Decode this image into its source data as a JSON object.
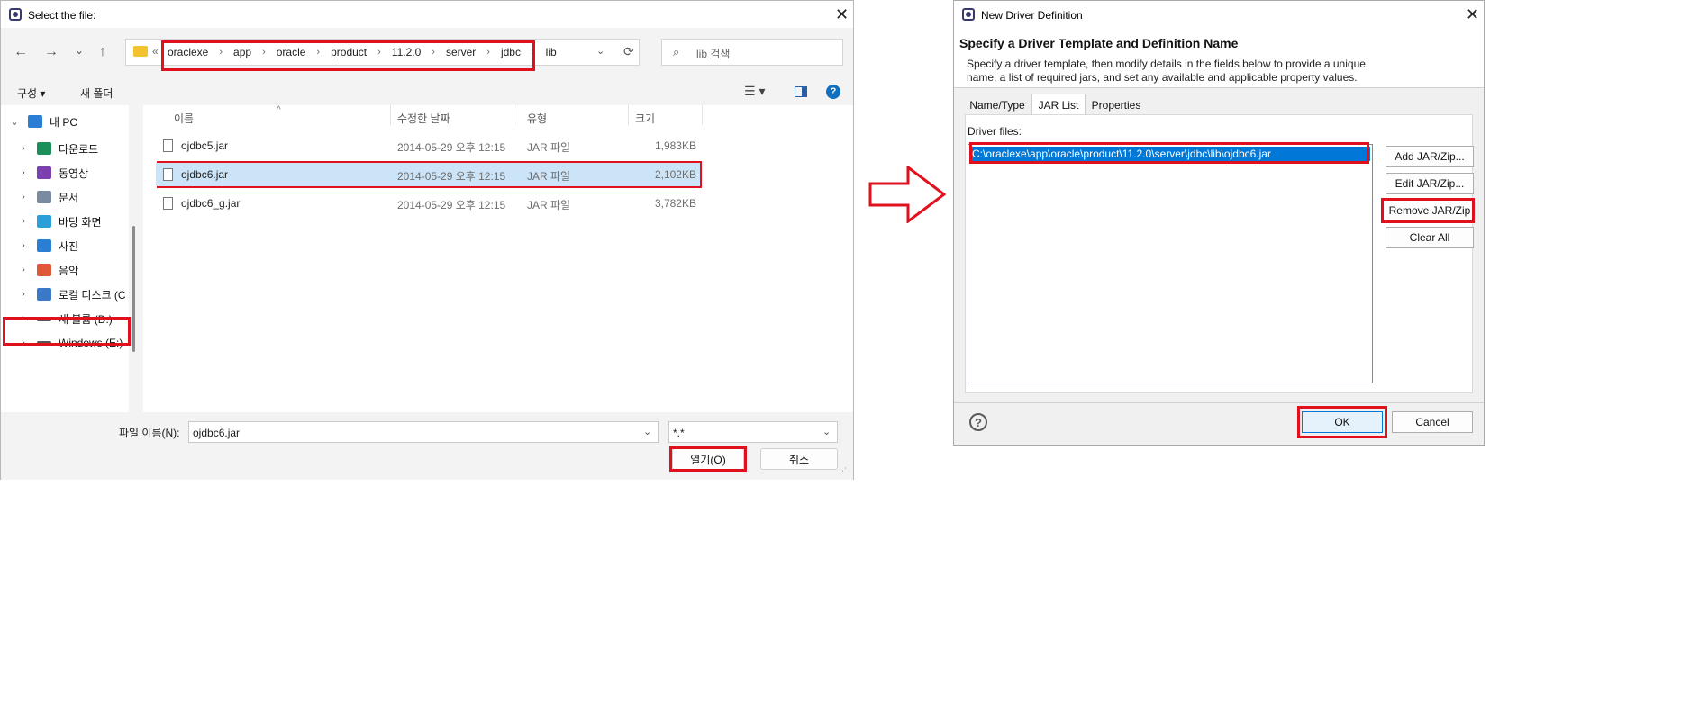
{
  "file_dialog": {
    "title": "Select the file:",
    "close_label": "✕",
    "nav": {
      "back": "←",
      "forward": "→",
      "recent": "⌄",
      "up": "↑"
    },
    "breadcrumb": {
      "overflow": "«",
      "items": [
        "oraclexe",
        "app",
        "oracle",
        "product",
        "11.2.0",
        "server",
        "jdbc",
        "lib"
      ],
      "separator": "›"
    },
    "search_placeholder": "lib 검색",
    "toolbar": {
      "organize": "구성 ▾",
      "new_folder": "새 폴더"
    },
    "sidebar": [
      {
        "label": "내 PC",
        "icon": "pc-icon",
        "color": "#2a7fd4"
      },
      {
        "label": "다운로드",
        "icon": "download-icon",
        "color": "#1a8f5a"
      },
      {
        "label": "동영상",
        "icon": "video-icon",
        "color": "#7b3fb0"
      },
      {
        "label": "문서",
        "icon": "document-icon",
        "color": "#7a8aa0"
      },
      {
        "label": "바탕 화면",
        "icon": "desktop-icon",
        "color": "#2a9fd8"
      },
      {
        "label": "사진",
        "icon": "photo-icon",
        "color": "#2a7fd4"
      },
      {
        "label": "음악",
        "icon": "music-icon",
        "color": "#e0573a"
      },
      {
        "label": "로컬 디스크 (C",
        "icon": "disk-icon",
        "color": "#3a78c8"
      },
      {
        "label": "새 볼륨 (D:)",
        "icon": "drive-icon",
        "color": "#555555"
      },
      {
        "label": "Windows (E:)",
        "icon": "drive-icon",
        "color": "#555555"
      }
    ],
    "columns": [
      "이름",
      "수정한 날짜",
      "유형",
      "크기"
    ],
    "files": [
      {
        "name": "ojdbc5.jar",
        "date": "2014-05-29 오후 12:15",
        "type": "JAR 파일",
        "size": "1,983KB"
      },
      {
        "name": "ojdbc6.jar",
        "date": "2014-05-29 오후 12:15",
        "type": "JAR 파일",
        "size": "2,102KB"
      },
      {
        "name": "ojdbc6_g.jar",
        "date": "2014-05-29 오후 12:15",
        "type": "JAR 파일",
        "size": "3,782KB"
      }
    ],
    "selected_index": 1,
    "filename_label": "파일 이름(N):",
    "filename_value": "ojdbc6.jar",
    "filter_value": "*.*",
    "open_button": "열기(O)",
    "cancel_button": "취소"
  },
  "arrow": {
    "color": "#e0101d"
  },
  "driver_dialog": {
    "title": "New Driver Definition",
    "heading": "Specify a Driver Template and Definition Name",
    "description_line1": "Specify a driver template, then modify details in the fields below to provide a unique",
    "description_line2": "name, a list of required jars, and set any available and applicable property values.",
    "tabs": [
      "Name/Type",
      "JAR List",
      "Properties"
    ],
    "active_tab": "JAR List",
    "driver_files_label": "Driver files:",
    "driver_files": [
      "C:\\oraclexe\\app\\oracle\\product\\11.2.0\\server\\jdbc\\lib\\ojdbc6.jar"
    ],
    "buttons": [
      "Add JAR/Zip...",
      "Edit JAR/Zip...",
      "Remove JAR/Zip",
      "Clear All"
    ],
    "ok": "OK",
    "cancel": "Cancel",
    "help": "?"
  },
  "colors": {
    "highlight": "#e0101d",
    "selection": "#cce4f7",
    "list_selection": "#0078d7"
  }
}
